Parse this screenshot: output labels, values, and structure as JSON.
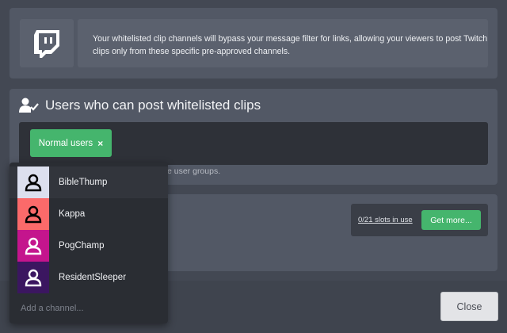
{
  "info": {
    "icon": "twitch-logo",
    "text": "Your whitelisted clip channels will bypass your message filter for links, allowing your viewers to post Twitch clips only from these specific pre-approved channels."
  },
  "users_section": {
    "title": "Users who can post whitelisted clips",
    "icon": "user-check-icon",
    "groups": [
      {
        "label": "Normal users",
        "remove": "×"
      }
    ],
    "helper_text": "e user groups."
  },
  "channels_section": {
    "slots_label": "0/21 slots in use",
    "get_more_label": "Get more..."
  },
  "dropdown": {
    "options": [
      {
        "name": "BibleThump",
        "avatar_color": "#dcdfee"
      },
      {
        "name": "Kappa",
        "avatar_color": "#fb6a6a"
      },
      {
        "name": "PogChamp",
        "avatar_color": "#c4158d"
      },
      {
        "name": "ResidentSleeper",
        "avatar_color": "#3b1660"
      }
    ],
    "input_placeholder": "Add a channel..."
  },
  "footer": {
    "close_label": "Close"
  },
  "colors": {
    "accent_green": "#45b56d",
    "background": "#434853"
  }
}
